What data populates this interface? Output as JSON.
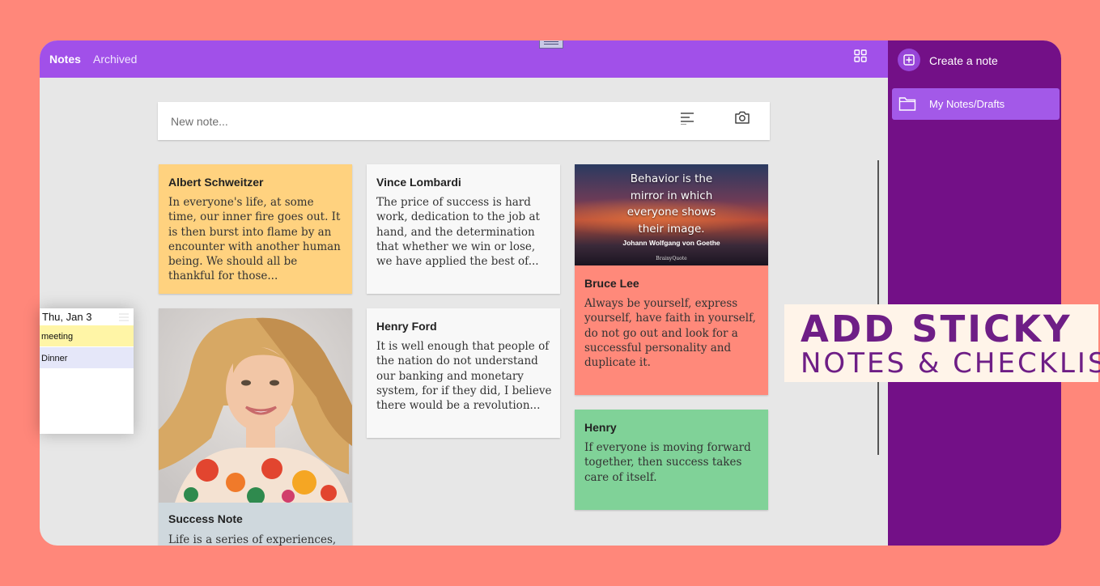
{
  "header": {
    "tab_notes": "Notes",
    "tab_archived": "Archived",
    "layout_icon": "grid-view-icon"
  },
  "sidebar": {
    "create_label": "Create a note",
    "folder_label": "My Notes/Drafts"
  },
  "new_note": {
    "placeholder": "New note...",
    "list_icon": "list-icon",
    "camera_icon": "camera-icon"
  },
  "notes": [
    {
      "title": "Albert Schweitzer",
      "body": "In everyone's life, at some time, our inner fire goes out. It is then burst into flame by an encounter with another human being. We should all be thankful for those...",
      "color": "#FFD27F"
    },
    {
      "title": "Vince Lombardi",
      "body": "The price of success is hard work, dedication to the job at hand, and the determination that whether we win or lose, we have applied the best of...",
      "color": "#F8F8F8"
    },
    {
      "image_lines": [
        "Behavior is the",
        "mirror in which",
        "everyone shows",
        "their image."
      ],
      "image_author": "Johann Wolfgang von Goethe",
      "image_brand": "BrainyQuote",
      "title": "Bruce Lee",
      "body": "Always be yourself, express yourself, have faith in yourself, do not go out and look for a successful personality and duplicate it.",
      "color": "#FF897A"
    },
    {
      "title": "Henry Ford",
      "body": "It is well enough that people of the nation do not understand our banking and monetary system, for if they did, I believe there would be a revolution...",
      "color": "#F8F8F8"
    },
    {
      "title": "Henry",
      "body": "If everyone is moving forward together, then success takes care of itself.",
      "color": "#80D298"
    },
    {
      "title": "Success Note",
      "body": "Life is a series of experiences,",
      "color": "#CFD8DD"
    }
  ],
  "calendar_widget": {
    "date": "Thu, Jan 3",
    "events": [
      {
        "label": "meeting",
        "color": "#FFF5A6"
      },
      {
        "label": "Dinner",
        "color": "#E5E7F9"
      }
    ]
  },
  "banner": {
    "line1": "ADD STICKY",
    "line2": "NOTES & CHECKLIST"
  }
}
